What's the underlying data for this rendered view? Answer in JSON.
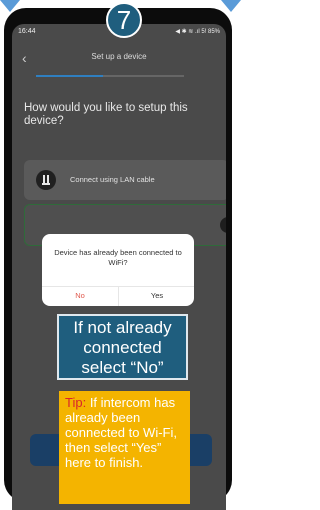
{
  "status_bar": {
    "time": "16:44",
    "right": "◀ ✱ ≋ .ıl 5! 85%"
  },
  "header": {
    "title": "Set up a device"
  },
  "setup_progress": 0.45,
  "question": "How would you like to setup this device?",
  "options": {
    "lan": {
      "label": "Connect using LAN cable",
      "icon": "lan-icon"
    },
    "wifi": {
      "icon": "wifi-icon"
    }
  },
  "dialog": {
    "message": "Device has already been connected to WiFi?",
    "no_label": "No",
    "yes_label": "Yes",
    "no_color": "#e05a4e"
  },
  "callout": {
    "text": "If not already connected select “No”"
  },
  "tip": {
    "label": "Tip:",
    "text": " If intercom has already been connected to Wi-Fi, then select “Yes” here to finish."
  },
  "step": {
    "number": "7"
  },
  "colors": {
    "accent": "#1f5e7e",
    "tip_bg": "#f4b400",
    "tip_label": "#d9262a"
  }
}
